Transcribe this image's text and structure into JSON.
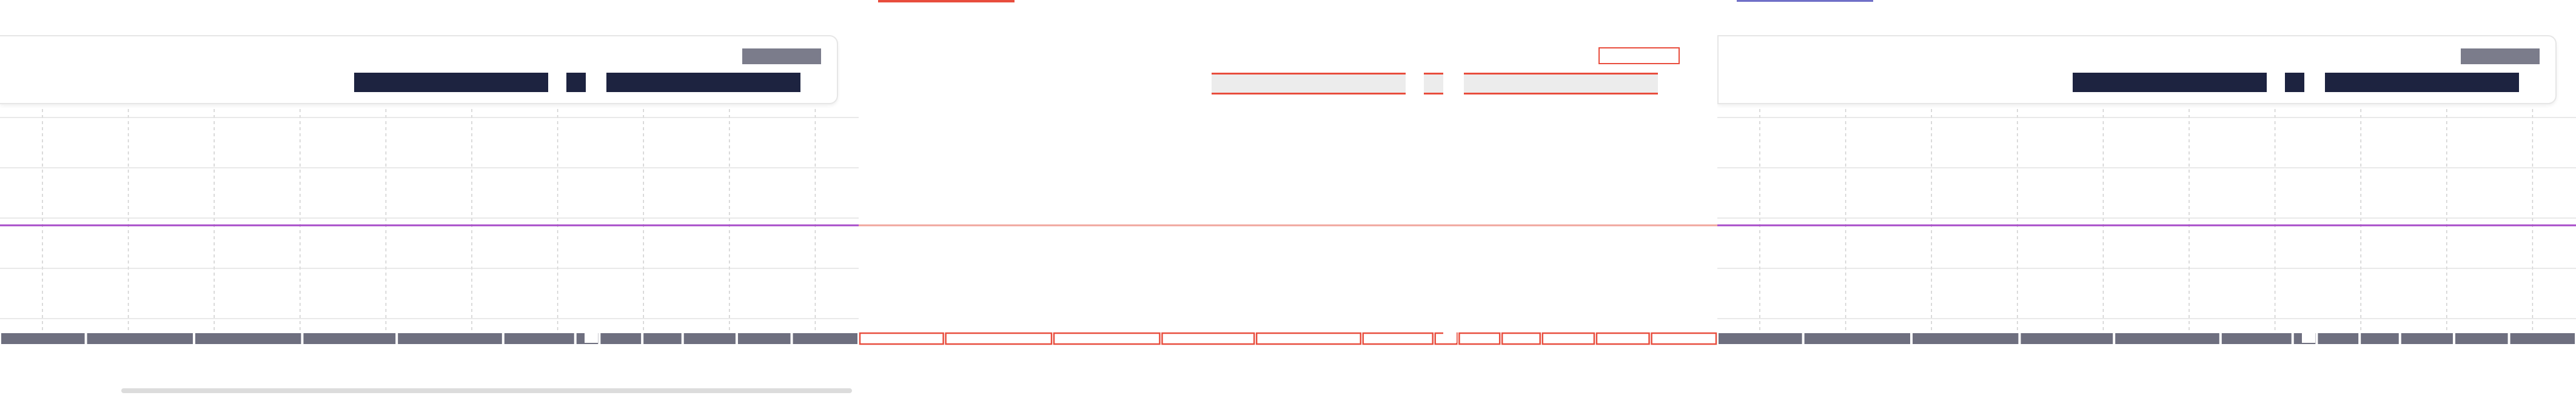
{
  "colors": {
    "series_line": "#a74bc9",
    "series_line_highlight": "#f0a59c",
    "grid": "#cfcfcf",
    "axis_band": "#6e6f7f",
    "header_block": "#1d2340",
    "header_badge": "#7b7c8b",
    "highlight_border": "#e84d3d",
    "accent_top_red": "#e84d3d",
    "accent_top_blue": "#7070c8"
  },
  "chart_data": [
    {
      "type": "line",
      "title": "",
      "xlabel": "",
      "ylabel": "",
      "grid": true,
      "gridlines_x": 10,
      "gridlines_y": 5,
      "series": [
        {
          "x": [
            0,
            1
          ],
          "values": [
            0.5,
            0.5
          ]
        }
      ],
      "axis_segments": [
        0,
        100,
        226,
        352,
        462,
        586,
        670,
        698,
        748,
        795,
        858,
        922,
        1000
      ]
    },
    {
      "type": "line",
      "title": "",
      "xlabel": "",
      "ylabel": "",
      "grid": true,
      "gridlines_x": 10,
      "gridlines_y": 5,
      "series": [
        {
          "x": [
            0,
            1
          ],
          "values": [
            0.5,
            0.5
          ]
        }
      ],
      "axis_segments": [
        0,
        100,
        226,
        352,
        462,
        586,
        670,
        698,
        748,
        795,
        858,
        922,
        1000
      ]
    },
    {
      "type": "line",
      "title": "",
      "xlabel": "",
      "ylabel": "",
      "grid": true,
      "gridlines_x": 10,
      "gridlines_y": 5,
      "series": [
        {
          "x": [
            0,
            1
          ],
          "values": [
            0.5,
            0.5
          ]
        }
      ],
      "axis_segments": [
        0,
        100,
        226,
        352,
        462,
        586,
        670,
        698,
        748,
        795,
        858,
        922,
        1000
      ]
    }
  ]
}
